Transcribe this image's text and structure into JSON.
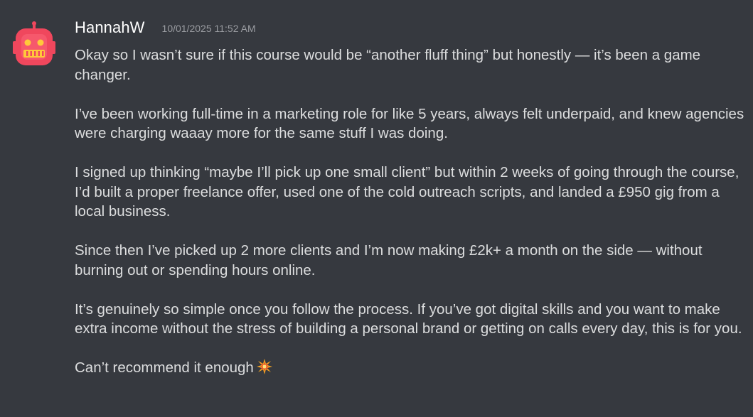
{
  "message": {
    "author": "HannahW",
    "avatar_icon": "robot-avatar-icon",
    "timestamp": "10/01/2025 11:52 AM",
    "paragraphs": [
      "Okay so I wasn’t sure if this course would be “another fluff thing” but honestly — it’s been a game changer.",
      "I’ve been working full-time in a marketing role for like 5 years, always felt underpaid, and knew agencies were charging waaay more for the same stuff I was doing.",
      "I signed up thinking “maybe I’ll pick up one small client” but within 2 weeks of going through the course, I’d built a proper freelance offer, used one of the cold outreach scripts, and landed a £950 gig from a local business.",
      "Since then I’ve picked up 2 more clients and I’m now making £2k+ a month on the side — without burning out or spending hours online.",
      "It’s genuinely so simple once you follow the process. If you’ve got digital skills and you want to make extra income without the stress of building a personal brand or getting on calls every day, this is for you.",
      "Can’t recommend it enough"
    ],
    "trailing_emoji": "collision-emoji-icon"
  },
  "colors": {
    "background": "#36393f",
    "text": "#dcddde",
    "username": "#ffffff",
    "timestamp": "#9a9ca1",
    "avatar_primary": "#f0475d"
  }
}
